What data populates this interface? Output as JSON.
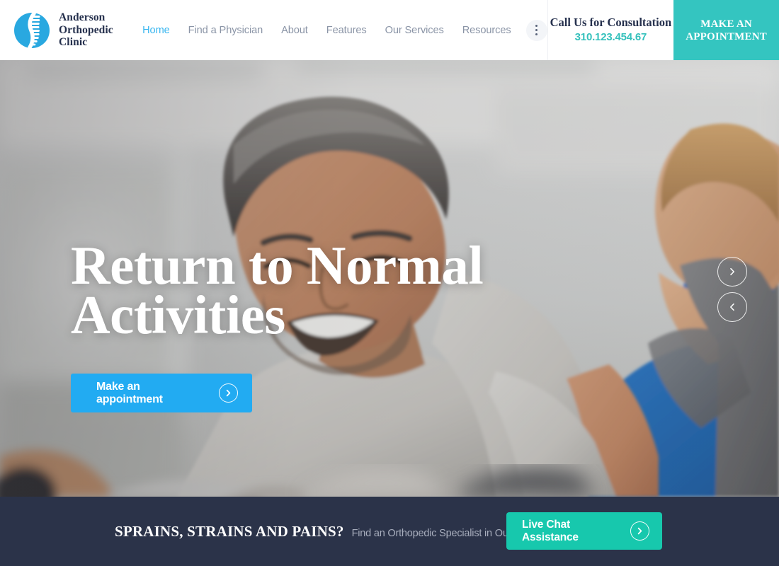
{
  "colors": {
    "teal": "#34c5c0",
    "teal_chat": "#17c8ad",
    "blue_cta": "#22abf2",
    "nav_active": "#38b6f0",
    "navy": "#2b3349",
    "brand_navy": "#25304d"
  },
  "header": {
    "logo_icon": "spine-logo-icon",
    "brand_name": "Anderson Orthopedic Clinic",
    "nav": [
      {
        "label": "Home",
        "active": true
      },
      {
        "label": "Find a Physician",
        "active": false
      },
      {
        "label": "About",
        "active": false
      },
      {
        "label": "Features",
        "active": false
      },
      {
        "label": "Our Services",
        "active": false
      },
      {
        "label": "Resources",
        "active": false
      }
    ],
    "more_icon": "vertical-dots-icon",
    "call": {
      "title": "Call Us for Consultation",
      "phone": "310.123.454.67"
    },
    "appointment_button": "MAKE AN APPOINTMENT"
  },
  "hero": {
    "title_line1": "Return to Normal",
    "title_line2": "Activities",
    "cta_label": "Make an appointment",
    "cta_icon": "chevron-right-icon",
    "slider_next_icon": "chevron-right-icon",
    "slider_prev_icon": "chevron-left-icon"
  },
  "bottom_bar": {
    "headline": "SPRAINS, STRAINS AND PAINS?",
    "subtext": "Find an Orthopedic Specialist in Our Clinic",
    "chat_label": "Live Chat Assistance",
    "chat_icon": "chevron-right-icon"
  }
}
